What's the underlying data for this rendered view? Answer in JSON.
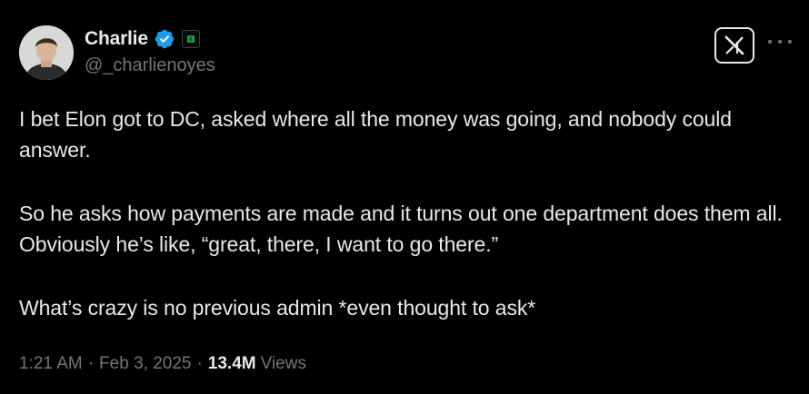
{
  "author": {
    "display_name": "Charlie",
    "handle": "@_charlienoyes",
    "verified": true,
    "verified_color": "#1d9bf0",
    "affiliation_badge_color": "#1aa34a"
  },
  "tweet": {
    "paragraphs": [
      "I bet Elon got to DC, asked where all the money was going, and nobody could answer.",
      "So he asks how payments are made and it turns out one department does them all. Obviously he’s like, “great, there, I want to go there.”",
      "What’s crazy is no previous admin *even thought to ask*"
    ],
    "time": "1:21 AM",
    "separator": "·",
    "date": "Feb 3, 2025",
    "views_count": "13.4M",
    "views_label": "Views"
  },
  "icons": {
    "logo": "x-logo-icon",
    "more": "more-icon",
    "verified": "verified-badge-icon"
  },
  "colors": {
    "background": "#000000",
    "primary_text": "#e7e9ea",
    "secondary_text": "#71767b"
  }
}
